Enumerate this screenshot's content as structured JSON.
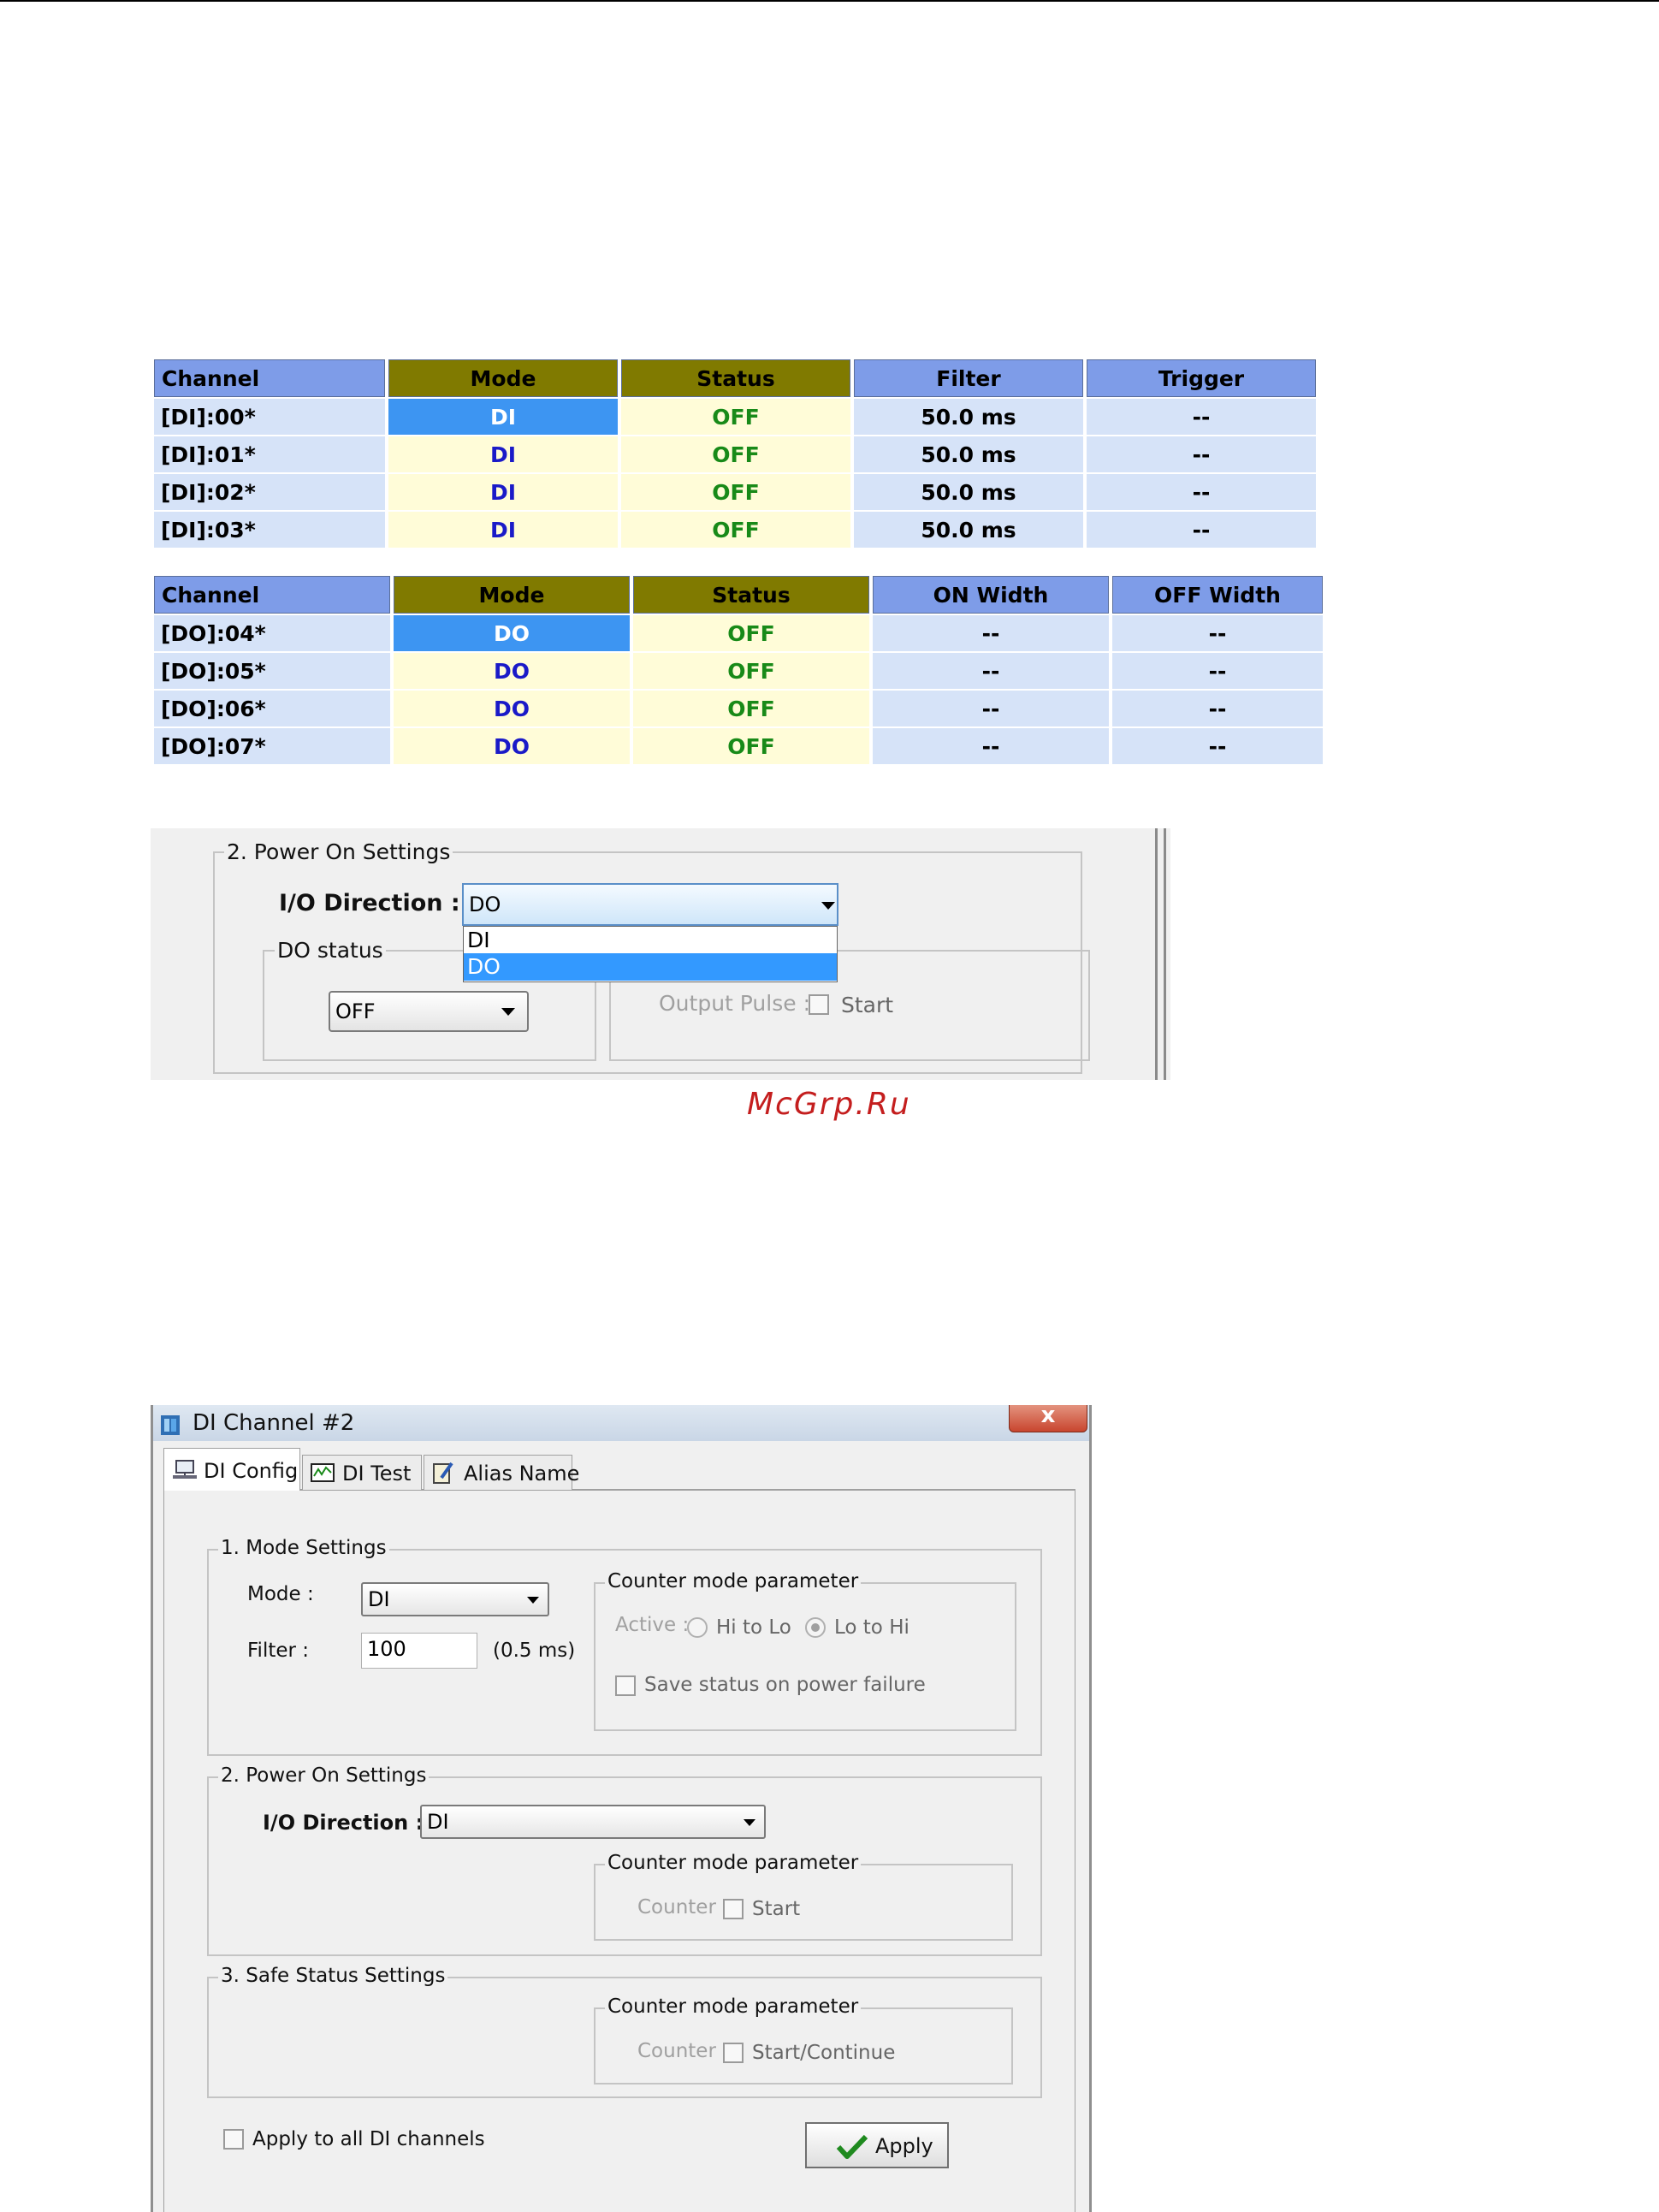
{
  "di_table": {
    "headers": [
      "Channel",
      "Mode",
      "Status",
      "Filter",
      "Trigger"
    ],
    "rows": [
      {
        "channel": "[DI]:00*",
        "mode": "DI",
        "status": "OFF",
        "filter": "50.0 ms",
        "trigger": "--"
      },
      {
        "channel": "[DI]:01*",
        "mode": "DI",
        "status": "OFF",
        "filter": "50.0 ms",
        "trigger": "--"
      },
      {
        "channel": "[DI]:02*",
        "mode": "DI",
        "status": "OFF",
        "filter": "50.0 ms",
        "trigger": "--"
      },
      {
        "channel": "[DI]:03*",
        "mode": "DI",
        "status": "OFF",
        "filter": "50.0 ms",
        "trigger": "--"
      }
    ]
  },
  "do_table": {
    "headers": [
      "Channel",
      "Mode",
      "Status",
      "ON Width",
      "OFF Width"
    ],
    "rows": [
      {
        "channel": "[DO]:04*",
        "mode": "DO",
        "status": "OFF",
        "on_width": "--",
        "off_width": "--"
      },
      {
        "channel": "[DO]:05*",
        "mode": "DO",
        "status": "OFF",
        "on_width": "--",
        "off_width": "--"
      },
      {
        "channel": "[DO]:06*",
        "mode": "DO",
        "status": "OFF",
        "on_width": "--",
        "off_width": "--"
      },
      {
        "channel": "[DO]:07*",
        "mode": "DO",
        "status": "OFF",
        "on_width": "--",
        "off_width": "--"
      }
    ]
  },
  "power_on_panel": {
    "group_title": "2. Power On Settings",
    "io_direction_label": "I/O Direction :",
    "io_direction_value": "DO",
    "dropdown_options": [
      "DI",
      "DO"
    ],
    "do_status_group": "DO status",
    "do_status_value": "OFF",
    "output_pulse_label": "Output Pulse :",
    "start_label": "Start"
  },
  "watermark": "McGrp.Ru",
  "dialog": {
    "title": "DI Channel #2",
    "close_glyph": "x",
    "tabs": [
      "DI Config",
      "DI Test",
      "Alias Name"
    ],
    "mode_settings": {
      "title": "1. Mode Settings",
      "mode_label": "Mode :",
      "mode_value": "DI",
      "filter_label": "Filter :",
      "filter_value": "100",
      "filter_unit": "(0.5 ms)",
      "counter_title": "Counter mode parameter",
      "active_label": "Active :",
      "hi_to_lo": "Hi to Lo",
      "lo_to_hi": "Lo to Hi",
      "save_status": "Save status on power failure"
    },
    "power_on": {
      "title": "2. Power On Settings",
      "io_direction_label": "I/O Direction :",
      "io_direction_value": "DI",
      "counter_title": "Counter mode parameter",
      "counter_label": "Counter :",
      "start_label": "Start"
    },
    "safe_status": {
      "title": "3. Safe Status Settings",
      "counter_title": "Counter mode parameter",
      "counter_label": "Counter :",
      "start_continue": "Start/Continue"
    },
    "apply_all": "Apply to all DI channels",
    "apply_button": "Apply"
  }
}
